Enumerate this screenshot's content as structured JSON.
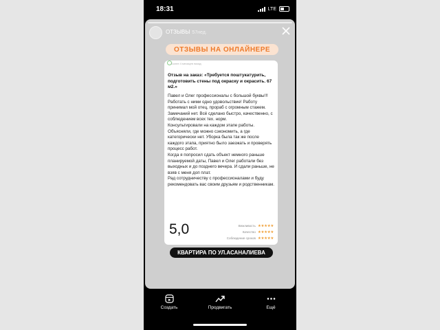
{
  "status_bar": {
    "time": "18:31",
    "network": "LTE"
  },
  "story": {
    "username": "ОТЗЫВЫ",
    "age": "57нед.",
    "header_pill": "ОТЗЫВЫ НА ОНЛАЙНЕРЕ",
    "card": {
      "meta": "Более 4 месяцев назад",
      "title": "Отзыв на заказ: «Требуется поштукатурить, подготовить стены под окраску и окрасить. 67 м2.»",
      "paragraphs": [
        "Павел и Олег профессионалы с большой буквы!!! Работать с ними одно удовольствие! Работу принимал мой отец, прораб с огромным стажем. Замечаний нет. Всё сделано быстро, качественно, с соблюдением всех тех. норм.",
        "Консультировали на каждом этапе работы. Объясняли, где можно сэкономить, а где категорически нет. Уборка была так же после каждого этапа, приятно было заезжать и проверять процесс работ.",
        "Когда я попросил сдать объект немного раньше планируемой даты, Павел и Олег работали без выходных и до позднего вечера. И сдали раньше, не взяв с меня доп плат.",
        "Рад сотрудничеству с профессионалами и буду рекомендовать вас своим друзьям и родственникам."
      ],
      "rating": "5,0",
      "criteria": [
        {
          "label": "Вежливость",
          "stars": "★★★★★"
        },
        {
          "label": "Качество",
          "stars": "★★★★★"
        },
        {
          "label": "Соблюдение сроков",
          "stars": "★★★★★"
        }
      ]
    },
    "footer_pill": "КВАРТИРА ПО УЛ.АСАНАЛИЕВА"
  },
  "toolbar": [
    {
      "label": "Создать",
      "icon": "create-reel-icon"
    },
    {
      "label": "Продвигать",
      "icon": "promote-trend-icon"
    },
    {
      "label": "Ещё",
      "icon": "more-dots-icon"
    }
  ],
  "colors": {
    "accent_orange": "#ee7a2a",
    "pill_bg": "#fbe3d1",
    "star": "#f0a13a"
  }
}
